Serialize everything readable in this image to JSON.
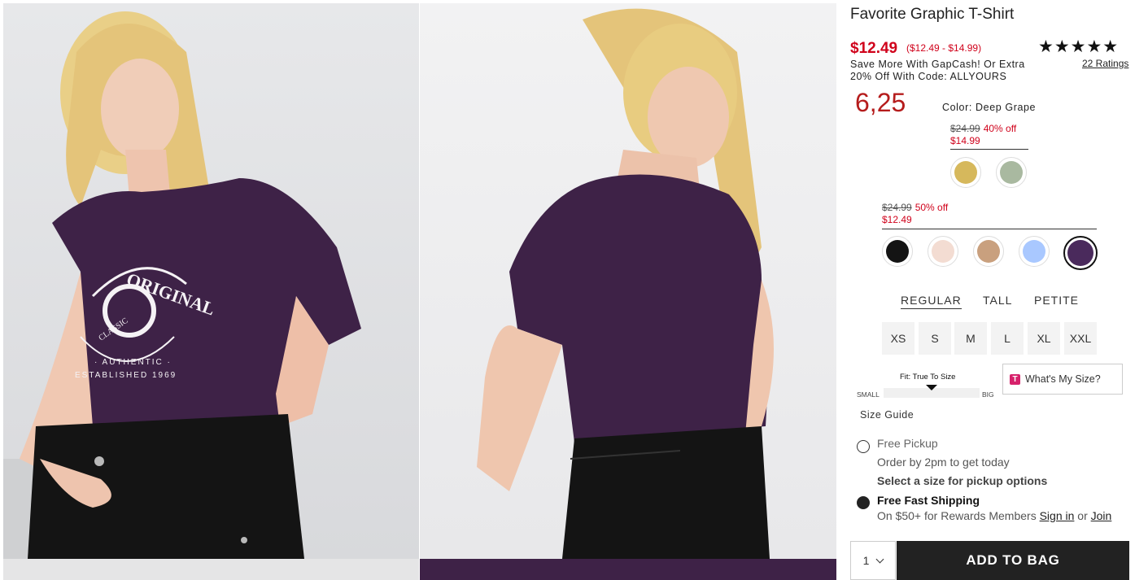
{
  "product": {
    "title": "Favorite Graphic T-Shirt",
    "price": "$12.49",
    "price_range": "($12.49 - $14.99)",
    "promo": "Save More With GapCash! Or Extra 20% Off With Code: ALLYOURS",
    "stars": "★★★★★",
    "ratings": "22 Ratings",
    "big_price": "6,25",
    "color_label": "Color: Deep Grape"
  },
  "tiers": [
    {
      "old": "$24.99",
      "pct": "40% off",
      "new": "$14.99",
      "swatches": [
        {
          "name": "mustard",
          "color": "#d6b85c"
        },
        {
          "name": "sage",
          "color": "#a9b9a0"
        }
      ]
    },
    {
      "old": "$24.99",
      "pct": "50% off",
      "new": "$12.49",
      "swatches": [
        {
          "name": "black",
          "color": "#141414"
        },
        {
          "name": "blush",
          "color": "#f3dcd2"
        },
        {
          "name": "tan-print",
          "color": "#c9a07e"
        },
        {
          "name": "light-blue",
          "color": "#a9c8ff"
        },
        {
          "name": "deep-grape",
          "color": "#4a2a5c"
        }
      ]
    }
  ],
  "fit_tabs": [
    "REGULAR",
    "TALL",
    "PETITE"
  ],
  "sizes": [
    "XS",
    "S",
    "M",
    "L",
    "XL",
    "XXL"
  ],
  "fit_meter": {
    "title": "Fit: True To Size",
    "small": "SMALL",
    "big": "BIG"
  },
  "whats_my_size": {
    "icon": "T",
    "label": "What's My Size?"
  },
  "size_guide": "Size Guide",
  "pickup": {
    "title": "Free Pickup",
    "line1": "Order by 2pm to get today",
    "line2": "Select a size for pickup options"
  },
  "shipping": {
    "title": "Free Fast Shipping",
    "line": "On $50+ for Rewards Members",
    "sign_in": "Sign in",
    "or": "or",
    "join": "Join"
  },
  "cart": {
    "qty": "1",
    "add_label": "ADD TO BAG"
  },
  "colors": {
    "accent_red": "#d0021b",
    "shirt": "#3e2247"
  },
  "photo_print": {
    "line1": "ORIGINAL",
    "line2": "CLASSIC",
    "line3": "· AUTHENTIC ·",
    "line4": "ESTABLISHED 1969"
  }
}
